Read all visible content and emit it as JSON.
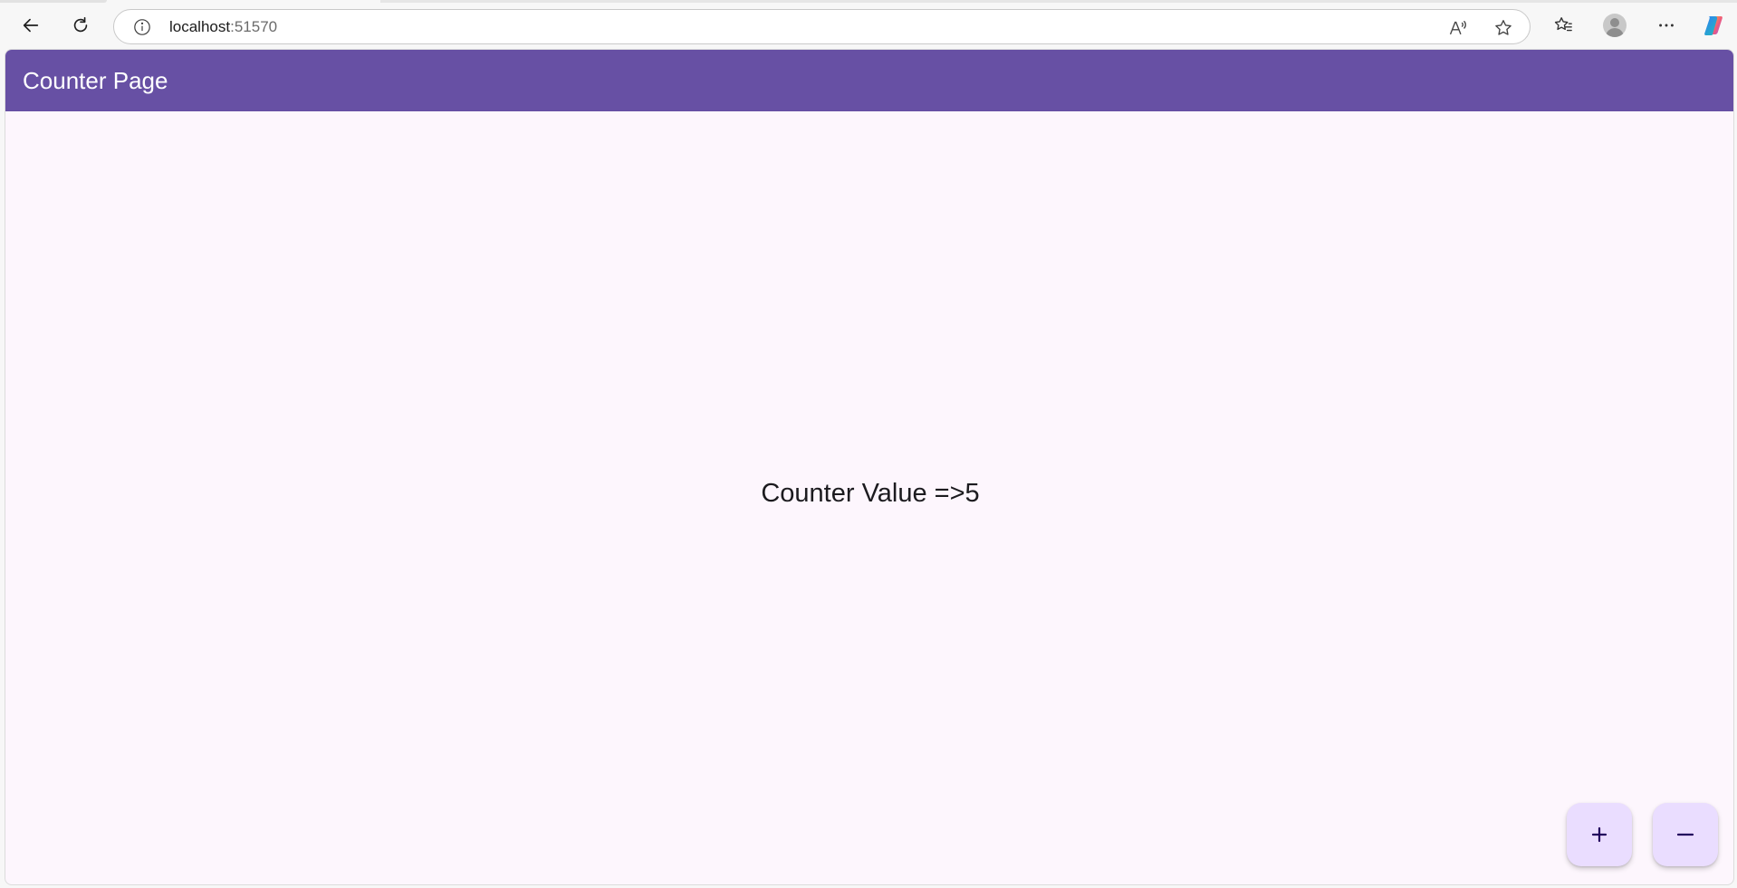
{
  "browser": {
    "url_host": "localhost",
    "url_port": ":51570",
    "icons": {
      "back": "back-arrow-icon",
      "refresh": "refresh-icon",
      "site_info": "info-icon",
      "read_aloud": "read-aloud-icon",
      "favorite": "star-icon",
      "favorites_list": "favorites-icon",
      "profile": "profile-avatar-icon",
      "more": "more-icon",
      "copilot": "copilot-icon"
    }
  },
  "app": {
    "title": "Counter Page",
    "counter_text": "Counter Value =>5",
    "colors": {
      "app_bar": "#6750a4",
      "background": "#fdf6fd",
      "fab": "#eaddff",
      "fab_icon": "#21005d"
    },
    "fabs": [
      {
        "name": "increment",
        "icon": "+"
      },
      {
        "name": "decrement",
        "icon": "−"
      }
    ]
  }
}
